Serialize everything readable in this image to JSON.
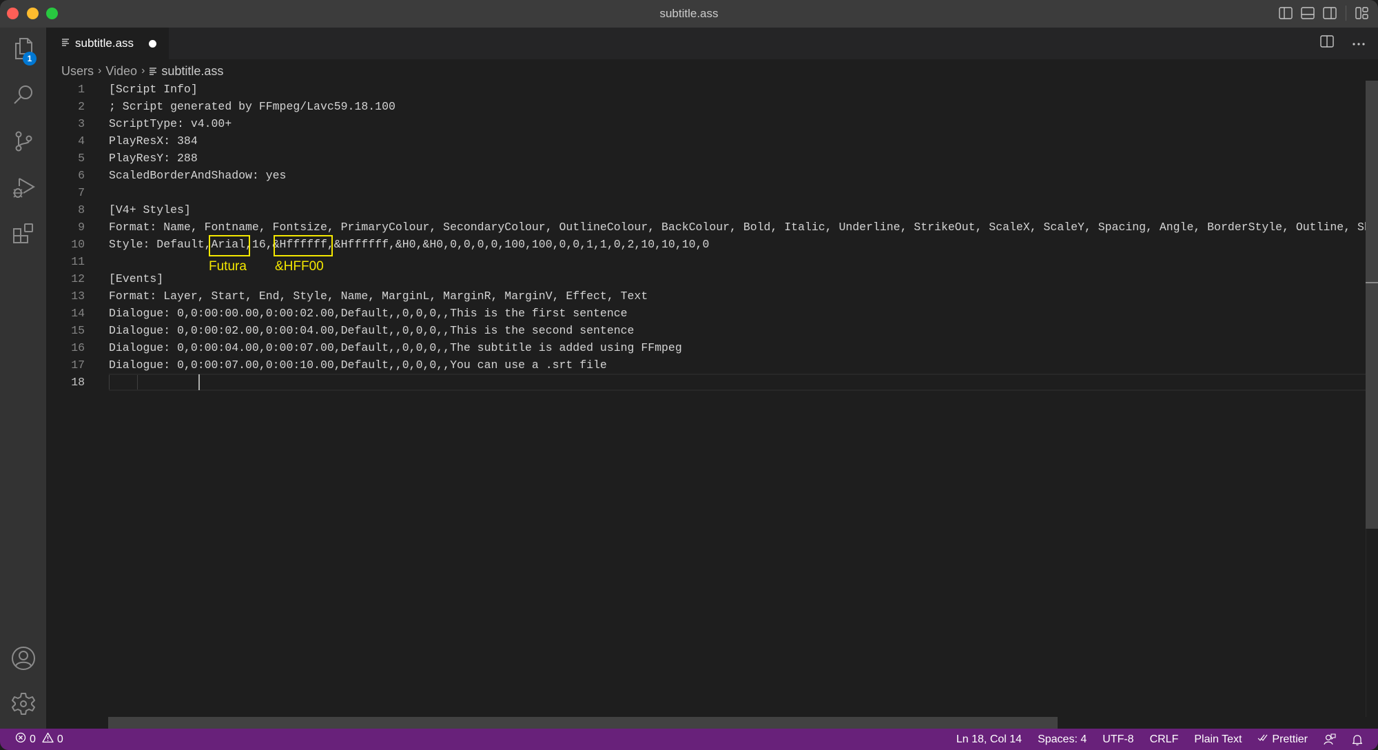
{
  "window": {
    "title": "subtitle.ass"
  },
  "activity_bar": {
    "items": [
      {
        "name": "explorer",
        "icon": "files-icon",
        "badge": "1"
      },
      {
        "name": "search",
        "icon": "search-icon"
      },
      {
        "name": "source-control",
        "icon": "source-control-icon"
      },
      {
        "name": "run-and-debug",
        "icon": "run-debug-icon"
      },
      {
        "name": "extensions",
        "icon": "extensions-icon"
      }
    ],
    "bottom_items": [
      {
        "name": "accounts",
        "icon": "account-icon"
      },
      {
        "name": "manage",
        "icon": "gear-icon"
      }
    ]
  },
  "tabs": [
    {
      "label": "subtitle.ass",
      "icon": "text-file-icon",
      "dirty": true,
      "active": true
    }
  ],
  "breadcrumb": {
    "items": [
      "Users",
      "Video"
    ],
    "file": "subtitle.ass"
  },
  "editor": {
    "lines": [
      {
        "n": "1",
        "text": "[Script Info]"
      },
      {
        "n": "2",
        "text": "; Script generated by FFmpeg/Lavc59.18.100"
      },
      {
        "n": "3",
        "text": "ScriptType: v4.00+"
      },
      {
        "n": "4",
        "text": "PlayResX: 384"
      },
      {
        "n": "5",
        "text": "PlayResY: 288"
      },
      {
        "n": "6",
        "text": "ScaledBorderAndShadow: yes"
      },
      {
        "n": "7",
        "text": ""
      },
      {
        "n": "8",
        "text": "[V4+ Styles]"
      },
      {
        "n": "9",
        "text": "Format: Name, Fontname, Fontsize, PrimaryColour, SecondaryColour, OutlineColour, BackColour, Bold, Italic, Underline, StrikeOut, ScaleX, ScaleY, Spacing, Angle, BorderStyle, Outline, Shadow, Alignment, MarginL, MarginR, MarginV, Encoding"
      },
      {
        "n": "10",
        "text": "Style: Default,Arial,16,&Hffffff,&Hffffff,&H0,&H0,0,0,0,0,100,100,0,0,1,1,0,2,10,10,10,0"
      },
      {
        "n": "11",
        "text": ""
      },
      {
        "n": "12",
        "text": "[Events]"
      },
      {
        "n": "13",
        "text": "Format: Layer, Start, End, Style, Name, MarginL, MarginR, MarginV, Effect, Text"
      },
      {
        "n": "14",
        "text": "Dialogue: 0,0:00:00.00,0:00:02.00,Default,,0,0,0,,This is the first sentence"
      },
      {
        "n": "15",
        "text": "Dialogue: 0,0:00:02.00,0:00:04.00,Default,,0,0,0,,This is the second sentence"
      },
      {
        "n": "16",
        "text": "Dialogue: 0,0:00:04.00,0:00:07.00,Default,,0,0,0,,The subtitle is added using FFmpeg"
      },
      {
        "n": "17",
        "text": "Dialogue: 0,0:00:07.00,0:00:10.00,Default,,0,0,0,,You can use a .srt file"
      },
      {
        "n": "18",
        "text": ""
      }
    ],
    "active_line": "18"
  },
  "annotations": [
    {
      "target": "Arial",
      "label": "Futura",
      "color": "#f5e800"
    },
    {
      "target": "&Hffffff",
      "label": "&HFF00",
      "color": "#f5e800"
    }
  ],
  "status_bar": {
    "errors": "0",
    "warnings": "0",
    "cursor_position": "Ln 18, Col 14",
    "indentation": "Spaces: 4",
    "encoding": "UTF-8",
    "eol": "CRLF",
    "language": "Plain Text",
    "formatter": "Prettier",
    "color": "#68217a"
  }
}
